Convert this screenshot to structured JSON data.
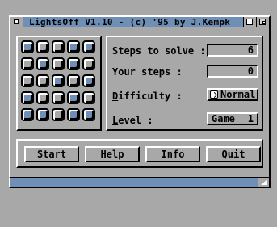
{
  "window": {
    "title": "LightsOff V1.10 - (c) '95 by J.Kempk"
  },
  "grid": {
    "rows": [
      [
        "on",
        "off",
        "off",
        "on",
        "on"
      ],
      [
        "off",
        "on",
        "off",
        "on",
        "off"
      ],
      [
        "off",
        "off",
        "on",
        "off",
        "on"
      ],
      [
        "on",
        "off",
        "off",
        "on",
        "off"
      ],
      [
        "on",
        "on",
        "off",
        "on",
        "on"
      ]
    ]
  },
  "stats": {
    "steps_to_solve_label": "Steps to solve :",
    "steps_to_solve_value": "6",
    "your_steps_label": "Your steps :",
    "your_steps_value": "0",
    "difficulty_label": "Difficulty :",
    "difficulty_value": "Normal",
    "level_label": "Level :",
    "level_value_prefix": "Game",
    "level_value_number": "1"
  },
  "buttons": {
    "start": "Start",
    "help": "Help",
    "info": "Info",
    "quit": "Quit"
  },
  "colors": {
    "accent": "#6f8fb7",
    "panel_gray": "#a8a8a8",
    "light_on": "#6f8fb7"
  },
  "icons": {
    "close": "close-gadget-icon",
    "depth": "depth-gadget-icon",
    "zoom": "zoom-gadget-icon",
    "cycle": "cycle-icon",
    "size": "size-gadget-icon"
  }
}
